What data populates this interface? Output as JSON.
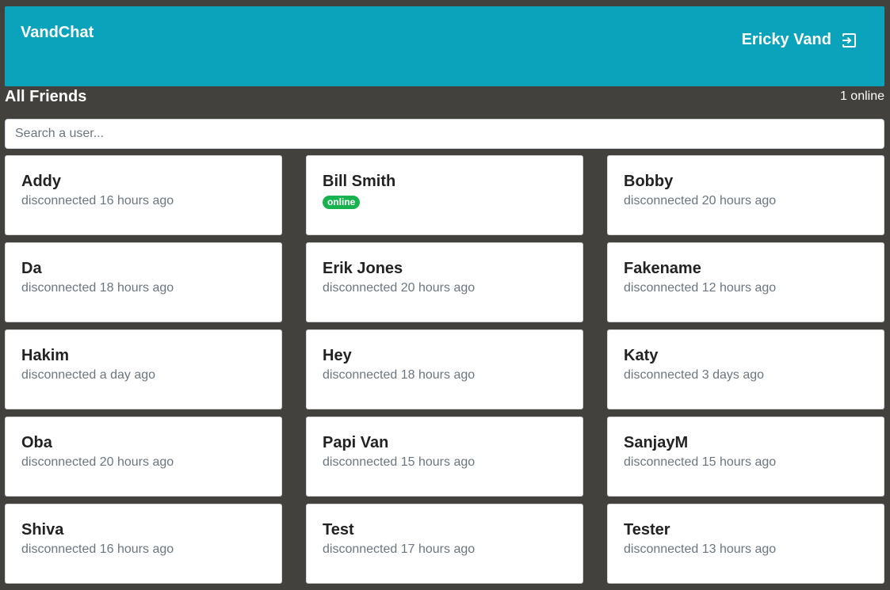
{
  "header": {
    "brand": "VandChat",
    "user_name": "Ericky Vand",
    "logout_icon": "logout-icon"
  },
  "friends": {
    "title": "All Friends",
    "online_count": "1 online",
    "search_placeholder": "Search a user...",
    "online_badge": "online",
    "colors": {
      "header": "#0ba3bc",
      "background": "#42413d",
      "online": "#16b34f"
    },
    "items": [
      {
        "name": "Addy",
        "status": "disconnected 16 hours ago",
        "online": false
      },
      {
        "name": "Bill Smith",
        "status": "online",
        "online": true
      },
      {
        "name": "Bobby",
        "status": "disconnected 20 hours ago",
        "online": false
      },
      {
        "name": "Da",
        "status": "disconnected 18 hours ago",
        "online": false
      },
      {
        "name": "Erik Jones",
        "status": "disconnected 20 hours ago",
        "online": false
      },
      {
        "name": "Fakename",
        "status": "disconnected 12 hours ago",
        "online": false
      },
      {
        "name": "Hakim",
        "status": "disconnected a day ago",
        "online": false
      },
      {
        "name": "Hey",
        "status": "disconnected 18 hours ago",
        "online": false
      },
      {
        "name": "Katy",
        "status": "disconnected 3 days ago",
        "online": false
      },
      {
        "name": "Oba",
        "status": "disconnected 20 hours ago",
        "online": false
      },
      {
        "name": "Papi Van",
        "status": "disconnected 15 hours ago",
        "online": false
      },
      {
        "name": "SanjayM",
        "status": "disconnected 15 hours ago",
        "online": false
      },
      {
        "name": "Shiva",
        "status": "disconnected 16 hours ago",
        "online": false
      },
      {
        "name": "Test",
        "status": "disconnected 17 hours ago",
        "online": false
      },
      {
        "name": "Tester",
        "status": "disconnected 13 hours ago",
        "online": false
      }
    ]
  }
}
